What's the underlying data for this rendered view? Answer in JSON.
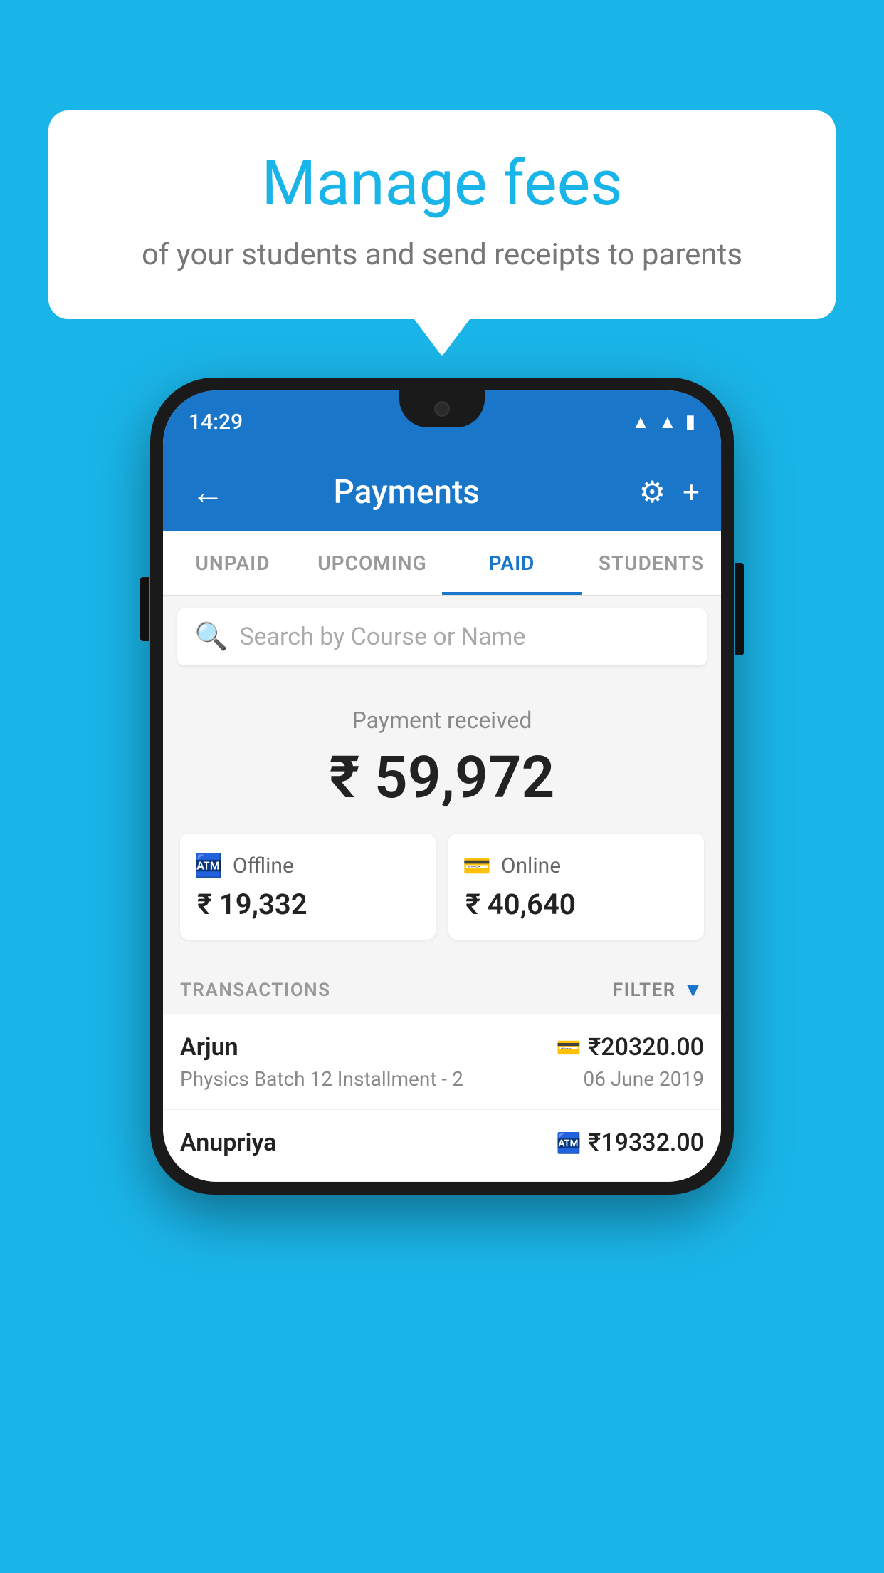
{
  "background_color": "#1ab5e8",
  "bubble": {
    "title": "Manage fees",
    "subtitle": "of your students and send receipts to parents"
  },
  "phone": {
    "status_time": "14:29",
    "app_bar": {
      "title": "Payments",
      "back_label": "←",
      "settings_icon": "⚙",
      "add_icon": "+"
    },
    "tabs": [
      {
        "label": "UNPAID",
        "active": false
      },
      {
        "label": "UPCOMING",
        "active": false
      },
      {
        "label": "PAID",
        "active": true
      },
      {
        "label": "STUDENTS",
        "active": false
      }
    ],
    "search": {
      "placeholder": "Search by Course or Name"
    },
    "payment_summary": {
      "label": "Payment received",
      "total": "₹ 59,972",
      "offline": {
        "type": "Offline",
        "amount": "₹ 19,332"
      },
      "online": {
        "type": "Online",
        "amount": "₹ 40,640"
      }
    },
    "transactions": {
      "header_label": "TRANSACTIONS",
      "filter_label": "FILTER",
      "rows": [
        {
          "name": "Arjun",
          "detail": "Physics Batch 12 Installment - 2",
          "amount": "₹20320.00",
          "date": "06 June 2019",
          "payment_type": "online"
        },
        {
          "name": "Anupriya",
          "detail": "",
          "amount": "₹19332.00",
          "date": "",
          "payment_type": "offline"
        }
      ]
    }
  }
}
